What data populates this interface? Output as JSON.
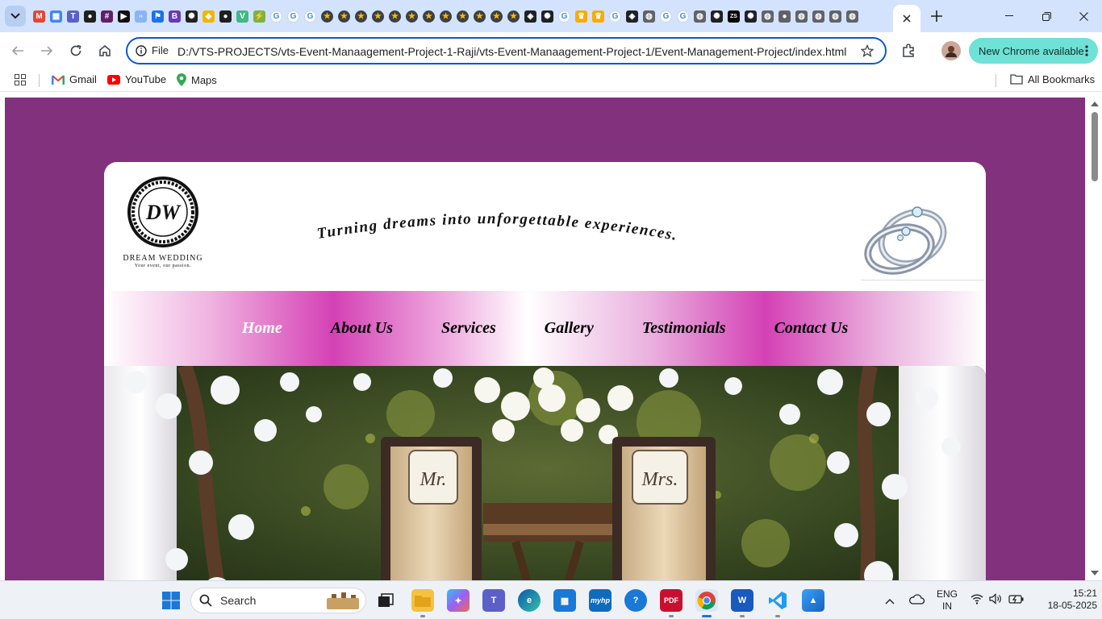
{
  "browser": {
    "pinned_tabs": [
      {
        "icon": "gmail-icon",
        "color": "#ea4335",
        "glyph": "M"
      },
      {
        "icon": "app-grid-icon",
        "color": "#4285f4",
        "glyph": "▦"
      },
      {
        "icon": "teams-icon",
        "color": "#5b5fc7",
        "glyph": "T"
      },
      {
        "icon": "github-icon",
        "color": "#1f1f1f",
        "glyph": "●"
      },
      {
        "icon": "slack-icon",
        "color": "#611f69",
        "glyph": "#"
      },
      {
        "icon": "play-icon",
        "color": "#111111",
        "glyph": "▶"
      },
      {
        "icon": "code-icon",
        "color": "#8ab4f8",
        "glyph": "‹›"
      },
      {
        "icon": "flag-icon",
        "color": "#1a73e8",
        "glyph": "⚑"
      },
      {
        "icon": "blog-icon",
        "color": "#673ab7",
        "glyph": "B"
      },
      {
        "icon": "openai-icon",
        "color": "#202124",
        "glyph": "✺"
      },
      {
        "icon": "course-icon",
        "color": "#f4b400",
        "glyph": "◆"
      },
      {
        "icon": "github-icon",
        "color": "#1f1f1f",
        "glyph": "●"
      },
      {
        "icon": "vue-icon",
        "color": "#42b883",
        "glyph": "V"
      },
      {
        "icon": "bolt-icon",
        "color": "#7cb342",
        "glyph": "⚡"
      },
      {
        "icon": "google-icon",
        "color": "#ffffff",
        "glyph": "G"
      },
      {
        "icon": "google-icon",
        "color": "#ffffff",
        "glyph": "G"
      },
      {
        "icon": "google-icon",
        "color": "#ffffff",
        "glyph": "G"
      },
      {
        "icon": "star-icon",
        "color": "#3c4043",
        "glyph": "★"
      },
      {
        "icon": "star-icon",
        "color": "#3c4043",
        "glyph": "★"
      },
      {
        "icon": "star-icon",
        "color": "#3c4043",
        "glyph": "★"
      },
      {
        "icon": "star-icon",
        "color": "#3c4043",
        "glyph": "★"
      },
      {
        "icon": "star-icon",
        "color": "#3c4043",
        "glyph": "★"
      },
      {
        "icon": "star-icon",
        "color": "#3c4043",
        "glyph": "★"
      },
      {
        "icon": "star-icon",
        "color": "#3c4043",
        "glyph": "★"
      },
      {
        "icon": "star-icon",
        "color": "#3c4043",
        "glyph": "★"
      },
      {
        "icon": "star-icon",
        "color": "#3c4043",
        "glyph": "★"
      },
      {
        "icon": "star-icon",
        "color": "#3c4043",
        "glyph": "★"
      },
      {
        "icon": "star-icon",
        "color": "#3c4043",
        "glyph": "★"
      },
      {
        "icon": "star-icon",
        "color": "#3c4043",
        "glyph": "★"
      },
      {
        "icon": "codepen-icon",
        "color": "#202124",
        "glyph": "◈"
      },
      {
        "icon": "chatgpt-icon",
        "color": "#202124",
        "glyph": "✺"
      },
      {
        "icon": "google-icon",
        "color": "#ffffff",
        "glyph": "G"
      },
      {
        "icon": "trophy-icon",
        "color": "#f9ab00",
        "glyph": "♛"
      },
      {
        "icon": "trophy-icon",
        "color": "#f9ab00",
        "glyph": "♛"
      },
      {
        "icon": "google-icon",
        "color": "#ffffff",
        "glyph": "G"
      },
      {
        "icon": "codepen-icon",
        "color": "#202124",
        "glyph": "◈"
      },
      {
        "icon": "globe-icon",
        "color": "#5f6368",
        "glyph": "◍"
      },
      {
        "icon": "google-icon",
        "color": "#ffffff",
        "glyph": "G"
      },
      {
        "icon": "google-icon",
        "color": "#ffffff",
        "glyph": "G"
      },
      {
        "icon": "globe-icon",
        "color": "#5f6368",
        "glyph": "◍"
      },
      {
        "icon": "openai-icon",
        "color": "#202124",
        "glyph": "✺"
      },
      {
        "icon": "zs-icon",
        "color": "#000000",
        "glyph": "ZS"
      },
      {
        "icon": "openai-icon",
        "color": "#202124",
        "glyph": "✺"
      },
      {
        "icon": "globe-icon",
        "color": "#5f6368",
        "glyph": "◍"
      },
      {
        "icon": "github-icon",
        "color": "#5f6368",
        "glyph": "●"
      },
      {
        "icon": "globe-icon",
        "color": "#5f6368",
        "glyph": "◍"
      },
      {
        "icon": "globe-icon",
        "color": "#5f6368",
        "glyph": "◍"
      },
      {
        "icon": "globe-icon",
        "color": "#5f6368",
        "glyph": "◍"
      },
      {
        "icon": "globe-icon",
        "color": "#5f6368",
        "glyph": "◍"
      }
    ],
    "address": {
      "scheme_label": "File",
      "url": "D:/VTS-PROJECTS/vts-Event-Manaagement-Project-1-Raji/vts-Event-Manaagement-Project-1/Event-Management-Project/index.html"
    },
    "update_button": "New Chrome available",
    "bookmarks": [
      {
        "label": "Gmail",
        "icon": "gmail-icon"
      },
      {
        "label": "YouTube",
        "icon": "youtube-icon"
      },
      {
        "label": "Maps",
        "icon": "maps-icon"
      }
    ],
    "all_bookmarks": "All Bookmarks"
  },
  "site": {
    "logo": {
      "monogram": "DW",
      "name": "DREAM WEDDING",
      "tagline": "Your event, our passion."
    },
    "slogan": "Turning dreams into unforgettable experiences.",
    "nav": [
      "Home",
      "About Us",
      "Services",
      "Gallery",
      "Testimonials",
      "Contact Us"
    ],
    "active_nav": "Home",
    "hero": {
      "chair_left": "Mr.",
      "chair_right": "Mrs."
    },
    "colors": {
      "page_bg": "#82317c",
      "nav_accent": "#d441b5"
    }
  },
  "taskbar": {
    "search_placeholder": "Search",
    "apps": [
      "start-icon",
      "task-view-icon",
      "file-explorer-icon",
      "copilot-icon",
      "teams-icon",
      "edge-icon",
      "store-icon",
      "myhp-icon",
      "help-icon",
      "pdf-icon",
      "chrome-icon",
      "word-icon",
      "vscode-icon",
      "photos-icon"
    ],
    "lang_top": "ENG",
    "lang_bottom": "IN",
    "time": "15:21",
    "date": "18-05-2025"
  }
}
